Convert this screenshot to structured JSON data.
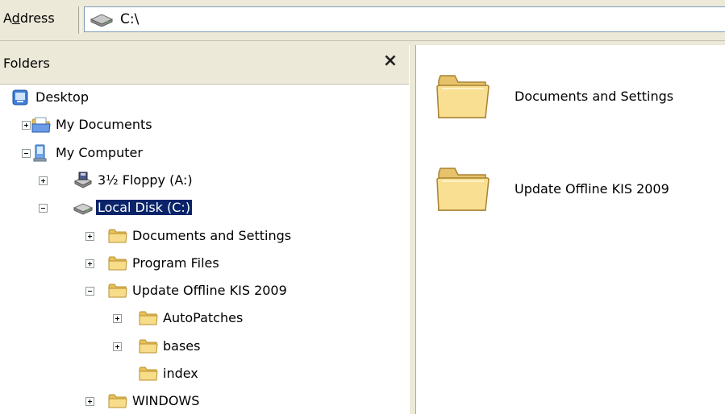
{
  "address": {
    "label": "Address",
    "value": "C:\\"
  },
  "folders": {
    "title": "Folders",
    "close": "×",
    "tree": [
      {
        "label": "Desktop",
        "icon": "desktop-icon",
        "level": 0,
        "expander": "none"
      },
      {
        "label": "My Documents",
        "icon": "my-documents-icon",
        "level": 1,
        "expander": "plus"
      },
      {
        "label": "My Computer",
        "icon": "my-computer-icon",
        "level": 1,
        "expander": "minus"
      },
      {
        "label": "3½ Floppy (A:)",
        "icon": "floppy-drive-icon",
        "level": 2,
        "expander": "plus"
      },
      {
        "label": "Local Disk (C:)",
        "icon": "hard-drive-icon",
        "level": 2,
        "expander": "minus",
        "selected": true
      },
      {
        "label": "Documents and Settings",
        "icon": "folder-icon",
        "level": 3,
        "expander": "plus"
      },
      {
        "label": "Program Files",
        "icon": "folder-icon",
        "level": 3,
        "expander": "plus"
      },
      {
        "label": "Update Offline KIS 2009",
        "icon": "folder-icon",
        "level": 3,
        "expander": "minus"
      },
      {
        "label": "AutoPatches",
        "icon": "folder-icon",
        "level": 4,
        "expander": "plus"
      },
      {
        "label": "bases",
        "icon": "folder-icon",
        "level": 4,
        "expander": "plus"
      },
      {
        "label": "index",
        "icon": "folder-icon",
        "level": 4,
        "expander": "none"
      },
      {
        "label": "WINDOWS",
        "icon": "folder-icon",
        "level": 3,
        "expander": "plus"
      }
    ]
  },
  "content": {
    "items": [
      {
        "label": "Documents and Settings",
        "icon": "large-folder-icon"
      },
      {
        "label": "Update Offline KIS 2009",
        "icon": "large-folder-icon"
      }
    ]
  },
  "colors": {
    "selection": "#0a246a",
    "folder": "#f5d97a",
    "chrome": "#ece9d8"
  }
}
